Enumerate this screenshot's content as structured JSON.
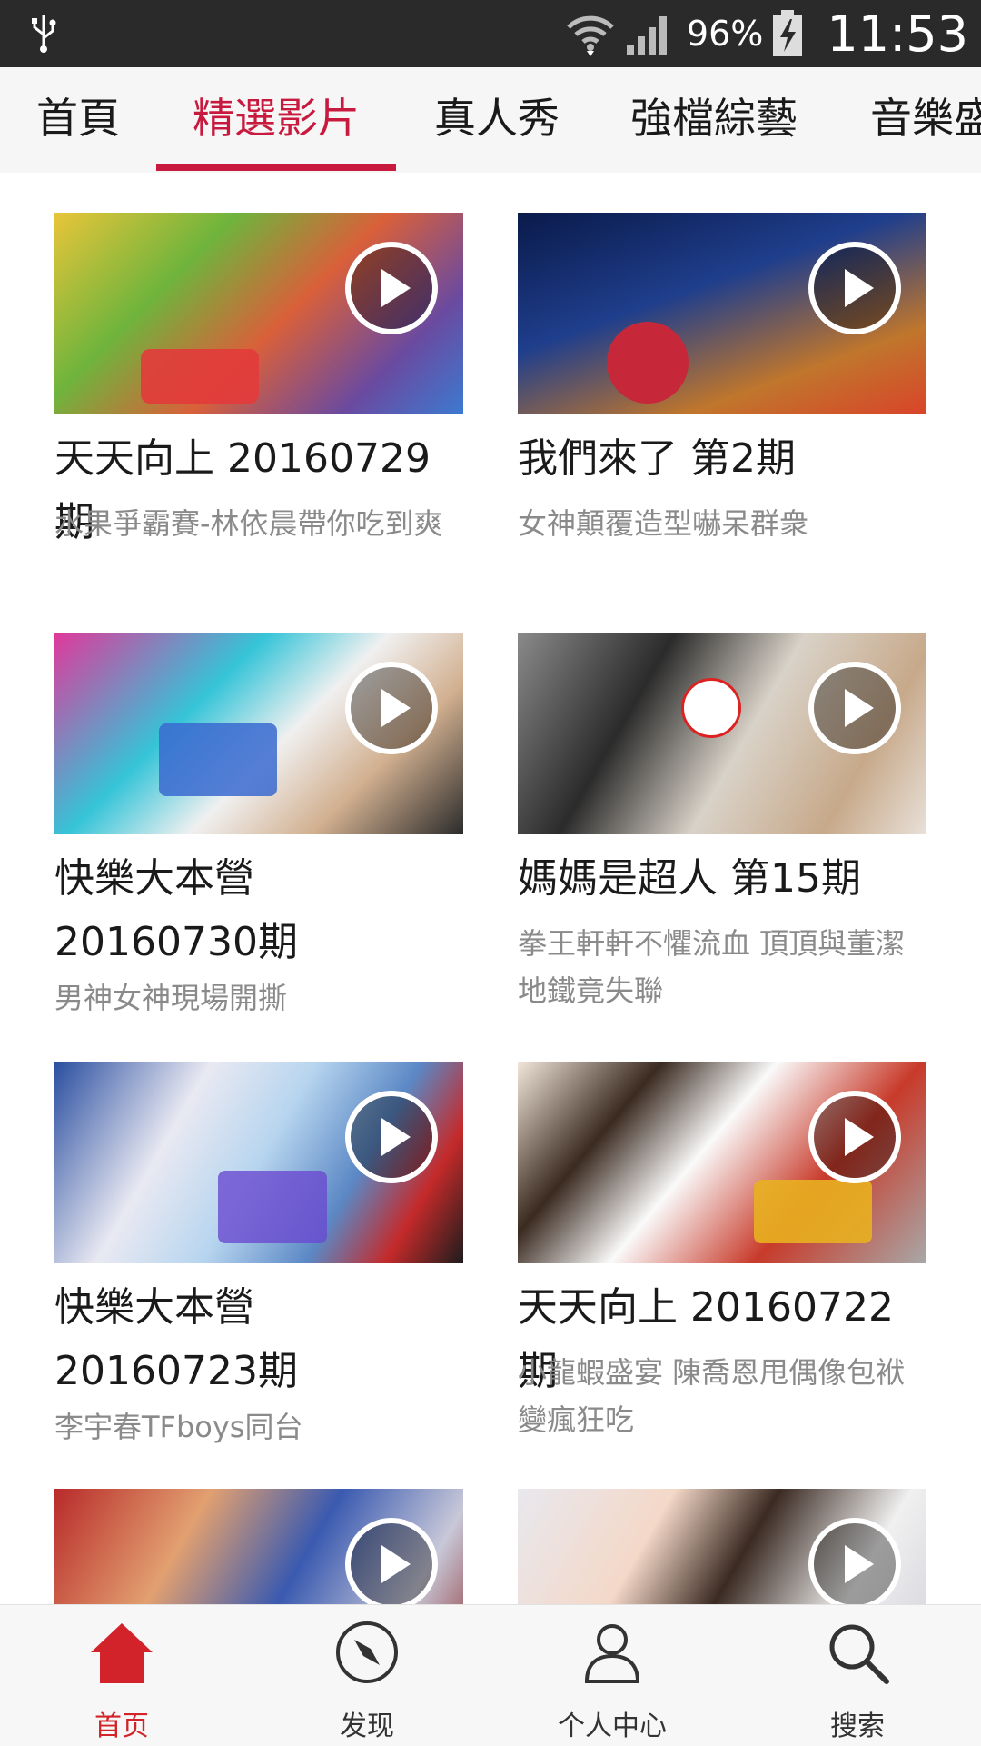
{
  "statusbar": {
    "battery_text": "96%",
    "time": "11:53",
    "icons": [
      "usb-icon",
      "wifi-icon",
      "signal-icon",
      "battery-icon"
    ]
  },
  "tabs": [
    {
      "label": "首頁",
      "active": false
    },
    {
      "label": "精選影片",
      "active": true
    },
    {
      "label": "真人秀",
      "active": false
    },
    {
      "label": "強檔綜藝",
      "active": false
    },
    {
      "label": "音樂盛",
      "active": false
    }
  ],
  "accent_color": "#c8193f",
  "cards": [
    {
      "title": "天天向上 20160729期",
      "subtitle": "水果爭霸賽-林依晨帶你吃到爽"
    },
    {
      "title": "我們來了 第2期",
      "subtitle": "女神顛覆造型嚇呆群衆"
    },
    {
      "title": "快樂大本營 20160730期",
      "subtitle": "男神女神現場開撕"
    },
    {
      "title": "媽媽是超人 第15期",
      "subtitle": "拳王軒軒不懼流血 頂頂與董潔地鐵竟失聯"
    },
    {
      "title": "快樂大本營 20160723期",
      "subtitle": "李宇春TFboys同台"
    },
    {
      "title": "天天向上 20160722期",
      "subtitle": "小龍蝦盛宴 陳喬恩甩偶像包袱變瘋狂吃"
    },
    {
      "title": "",
      "subtitle": ""
    },
    {
      "title": "",
      "subtitle": ""
    }
  ],
  "bottom_nav": [
    {
      "label": "首页",
      "icon": "home-icon",
      "active": true
    },
    {
      "label": "发现",
      "icon": "compass-icon",
      "active": false
    },
    {
      "label": "个人中心",
      "icon": "user-icon",
      "active": false
    },
    {
      "label": "搜索",
      "icon": "search-icon",
      "active": false
    }
  ]
}
